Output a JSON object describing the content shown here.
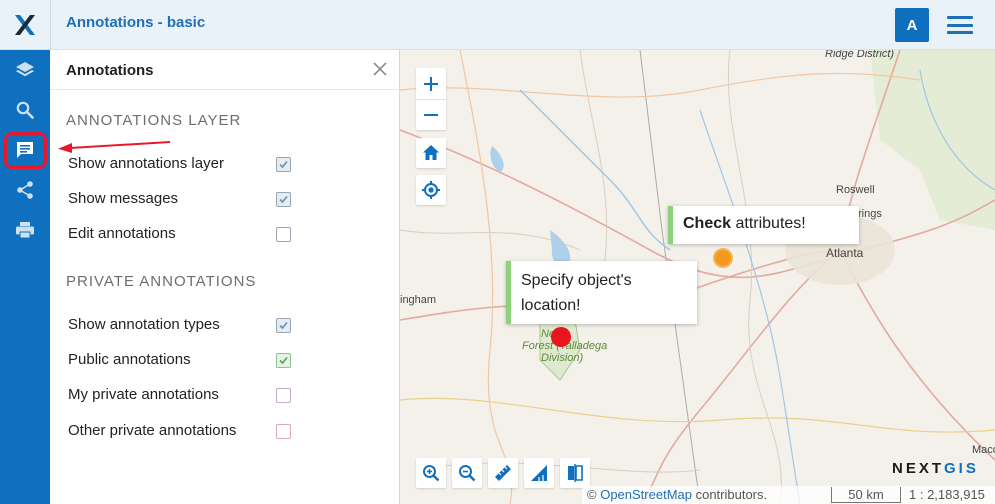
{
  "header": {
    "title": "Annotations - basic",
    "avatar_letter": "A"
  },
  "rail": {
    "items": [
      {
        "icon": "layers-icon"
      },
      {
        "icon": "search-icon"
      },
      {
        "icon": "annotations-icon",
        "active": true
      },
      {
        "icon": "share-icon"
      },
      {
        "icon": "print-icon"
      }
    ]
  },
  "panel": {
    "title": "Annotations",
    "section_layer": "Annotations layer",
    "show_layer": {
      "label": "Show annotations layer",
      "checked": true
    },
    "show_messages": {
      "label": "Show messages",
      "checked": true
    },
    "edit_annotations": {
      "label": "Edit annotations",
      "checked": false
    },
    "section_private": "Private annotations",
    "show_types": {
      "label": "Show annotation types",
      "checked": true
    },
    "public_annotations": {
      "label": "Public annotations",
      "checked": true
    },
    "my_private": {
      "label": "My private annotations",
      "checked": false
    },
    "other_private": {
      "label": "Other private annotations",
      "checked": false
    }
  },
  "map": {
    "popup1": {
      "bold": "Check",
      "rest": " attributes!"
    },
    "popup2": {
      "line1": "Specify object's",
      "line2": "location!"
    },
    "places": {
      "ridge": "Ridge District)",
      "roswell": "Roswell",
      "springs": "rings",
      "atlanta": "Atlanta",
      "birmingham": "ingham",
      "forest1": "Forest (Talladega",
      "forest2": "Division)",
      "national": "Ne",
      "macon": "Maco"
    },
    "brand": {
      "part1": "NEXT",
      "part2": "GIS"
    },
    "attribution_prefix": "© ",
    "attribution_link": "OpenStreetMap",
    "attribution_suffix": " contributors.",
    "scale_label": "50 km",
    "scale_ratio": "1 : 2,183,915"
  },
  "colors": {
    "brand_blue": "#0f70bf",
    "highlight_red": "#e8192c",
    "popup_bar": "#8fd07a",
    "marker_orange": "#f39a1e",
    "marker_red": "#e8151e"
  }
}
